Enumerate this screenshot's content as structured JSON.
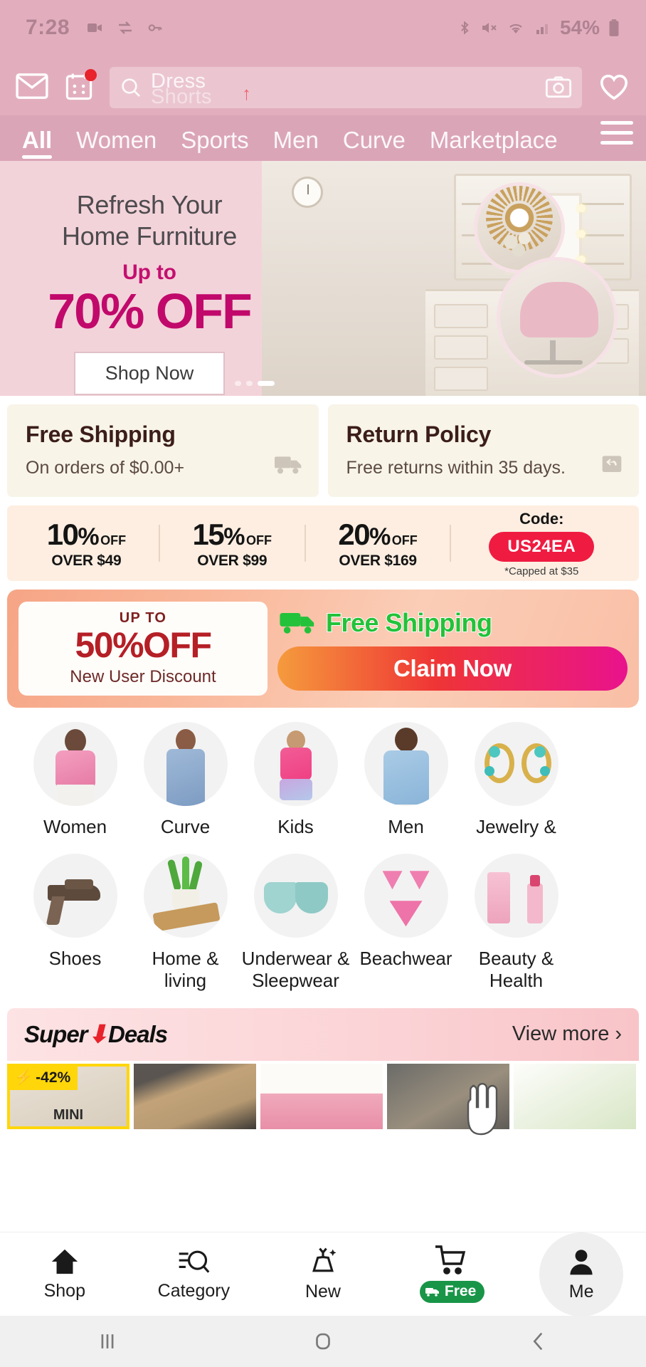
{
  "status_bar": {
    "time": "7:28",
    "battery": "54%",
    "left_icons": [
      "video-recording-icon",
      "swap-icon",
      "key-icon"
    ],
    "right_icons": [
      "bluetooth-icon",
      "mute-icon",
      "wifi-icon",
      "signal-icon",
      "battery-icon"
    ]
  },
  "header": {
    "mail_icon": "mail-icon",
    "calendar_icon": "calendar-icon",
    "search": {
      "placeholder_primary": "Dress",
      "placeholder_secondary": "Shorts",
      "search_icon": "search-icon",
      "camera_icon": "camera-icon"
    },
    "wishlist_icon": "heart-icon",
    "menu_icon": "hamburger-menu-icon",
    "accent_color": "#e2aebe"
  },
  "tabs": [
    {
      "label": "All",
      "active": true
    },
    {
      "label": "Women",
      "active": false
    },
    {
      "label": "Sports",
      "active": false
    },
    {
      "label": "Men",
      "active": false
    },
    {
      "label": "Curve",
      "active": false
    },
    {
      "label": "Marketplace",
      "active": false
    }
  ],
  "hero": {
    "headline_line1": "Refresh Your",
    "headline_line2": "Home Furniture",
    "up_to": "Up to",
    "discount": "70% OFF",
    "cta": "Shop Now",
    "discount_color": "#c1096b",
    "background": "#f3d3da",
    "dots": 3,
    "active_dot": 2
  },
  "policies": [
    {
      "title": "Free Shipping",
      "subtitle": "On orders of $0.00+",
      "icon": "truck-icon"
    },
    {
      "title": "Return Policy",
      "subtitle": "Free returns within 35 days.",
      "icon": "return-box-icon"
    }
  ],
  "coupon_tiers": {
    "tiers": [
      {
        "percent": "10",
        "off": "OFF",
        "threshold": "OVER $49"
      },
      {
        "percent": "15",
        "off": "OFF",
        "threshold": "OVER $99"
      },
      {
        "percent": "20",
        "off": "OFF",
        "threshold": "OVER $169"
      }
    ],
    "code_label": "Code:",
    "code": "US24EA",
    "note": "*Capped at $35",
    "code_color": "#f01b41"
  },
  "promo": {
    "up_to": "UP TO",
    "discount": "50%OFF",
    "caption": "New User Discount",
    "free_shipping": "Free Shipping",
    "truck_icon": "delivery-truck-icon",
    "cta": "Claim Now",
    "shipping_color": "#23c23a"
  },
  "categories": {
    "row1": [
      {
        "label": "Women",
        "image": "woman-in-pink-top"
      },
      {
        "label": "Curve",
        "image": "woman-in-denim-overalls"
      },
      {
        "label": "Kids",
        "image": "girl-in-swimsuit"
      },
      {
        "label": "Men",
        "image": "man-in-blue-polo"
      },
      {
        "label": "Jewelry &",
        "image": "turquoise-gold-earrings"
      }
    ],
    "row2": [
      {
        "label": "Shoes",
        "image": "brown-heeled-sandal"
      },
      {
        "label": "Home & living",
        "image": "potted-plant-board"
      },
      {
        "label": "Underwear & Sleepwear",
        "image": "teal-strapless-bra"
      },
      {
        "label": "Beachwear",
        "image": "pink-bikini"
      },
      {
        "label": "Beauty & Health",
        "image": "pink-cosmetics"
      }
    ]
  },
  "super_deals": {
    "title_part1": "Super",
    "title_part2": "Deals",
    "arrow_icon": "down-arrow-icon",
    "view_more": "View more",
    "chevron_icon": "chevron-right-icon",
    "products": [
      {
        "discount": "-42%",
        "flash_icon": "lightning-icon",
        "caption": "MINI"
      },
      {
        "discount": "",
        "flash_icon": "",
        "caption": ""
      },
      {
        "discount": "",
        "flash_icon": "",
        "caption": ""
      },
      {
        "discount": "",
        "flash_icon": "",
        "caption": ""
      },
      {
        "discount": "",
        "flash_icon": "",
        "caption": ""
      }
    ]
  },
  "bottom_nav": [
    {
      "label": "Shop",
      "icon": "home-icon",
      "active": false,
      "badge": ""
    },
    {
      "label": "Category",
      "icon": "category-search-icon",
      "active": false,
      "badge": ""
    },
    {
      "label": "New",
      "icon": "dress-sparkle-icon",
      "active": false,
      "badge": ""
    },
    {
      "label": "",
      "icon": "cart-icon",
      "active": false,
      "badge": "Free"
    },
    {
      "label": "Me",
      "icon": "person-icon",
      "active": true,
      "badge": ""
    }
  ],
  "system_nav": [
    {
      "icon": "recents-icon"
    },
    {
      "icon": "home-square-icon"
    },
    {
      "icon": "back-chevron-icon"
    }
  ]
}
